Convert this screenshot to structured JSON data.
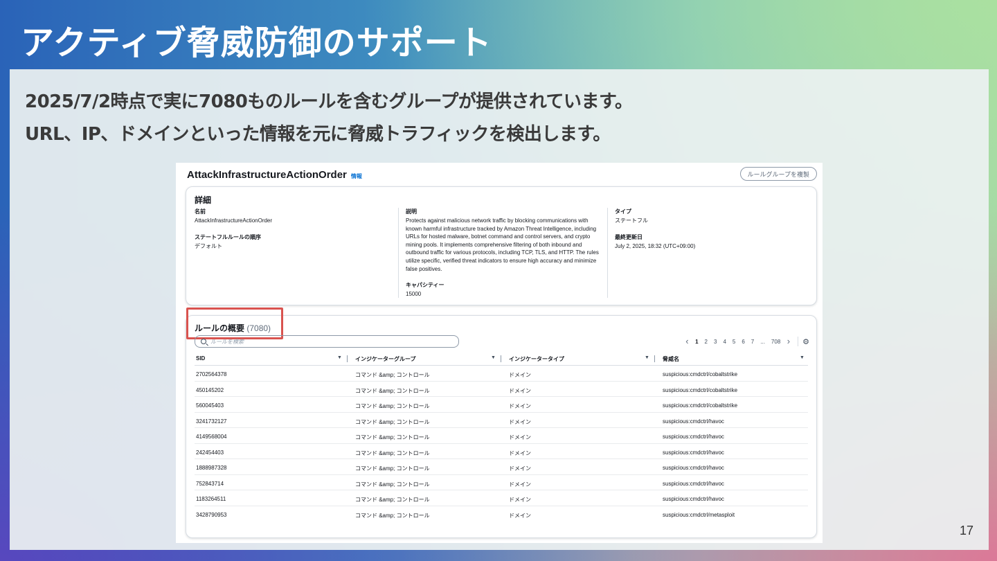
{
  "slide": {
    "title": "アクティブ脅威防御のサポート",
    "line1": "2025/7/2時点で実に7080ものルールを含むグループが提供されています。",
    "line2": "URL、IP、ドメインといった情報を元に脅威トラフィックを検出します。",
    "page_number": "17"
  },
  "console": {
    "rule_group_name": "AttackInfrastructureActionOrder",
    "info_link": "情報",
    "copy_button": "ルールグループを複製",
    "details": {
      "title": "詳細",
      "name_label": "名前",
      "name_value": "AttackInfrastructureActionOrder",
      "order_label": "ステートフルルールの順序",
      "order_value": "デフォルト",
      "description_label": "説明",
      "description_value": "Protects against malicious network traffic by blocking communications with known harmful infrastructure tracked by Amazon Threat Intelligence, including URLs for hosted malware, botnet command and control servers, and crypto mining pools. It implements comprehensive filtering of both inbound and outbound traffic for various protocols, including TCP, TLS, and HTTP. The rules utilize specific, verified threat indicators to ensure high accuracy and minimize false positives.",
      "capacity_label": "キャパシティー",
      "capacity_value": "15000",
      "type_label": "タイプ",
      "type_value": "ステートフル",
      "updated_label": "最終更新日",
      "updated_value": "July 2, 2025, 18:32 (UTC+09:00)"
    },
    "rules": {
      "title": "ルールの概要",
      "count": "(7080)",
      "search_placeholder": "ルールを検索",
      "pages": [
        "1",
        "2",
        "3",
        "4",
        "5",
        "6",
        "7",
        "...",
        "708"
      ],
      "columns": [
        "SID",
        "インジケーターグループ",
        "インジケータータイプ",
        "脅威名"
      ],
      "rows": [
        [
          "2702564378",
          "コマンド &amp; コントロール",
          "ドメイン",
          "suspicious:cmdctrl/cobaltstrike"
        ],
        [
          "450145202",
          "コマンド &amp; コントロール",
          "ドメイン",
          "suspicious:cmdctrl/cobaltstrike"
        ],
        [
          "560045403",
          "コマンド &amp; コントロール",
          "ドメイン",
          "suspicious:cmdctrl/cobaltstrike"
        ],
        [
          "3241732127",
          "コマンド &amp; コントロール",
          "ドメイン",
          "suspicious:cmdctrl/havoc"
        ],
        [
          "4149568004",
          "コマンド &amp; コントロール",
          "ドメイン",
          "suspicious:cmdctrl/havoc"
        ],
        [
          "242454403",
          "コマンド &amp; コントロール",
          "ドメイン",
          "suspicious:cmdctrl/havoc"
        ],
        [
          "1888987328",
          "コマンド &amp; コントロール",
          "ドメイン",
          "suspicious:cmdctrl/havoc"
        ],
        [
          "752843714",
          "コマンド &amp; コントロール",
          "ドメイン",
          "suspicious:cmdctrl/havoc"
        ],
        [
          "1183264511",
          "コマンド &amp; コントロール",
          "ドメイン",
          "suspicious:cmdctrl/havoc"
        ],
        [
          "3428790953",
          "コマンド &amp; コントロール",
          "ドメイン",
          "suspicious:cmdctrl/metasploit"
        ]
      ]
    }
  }
}
